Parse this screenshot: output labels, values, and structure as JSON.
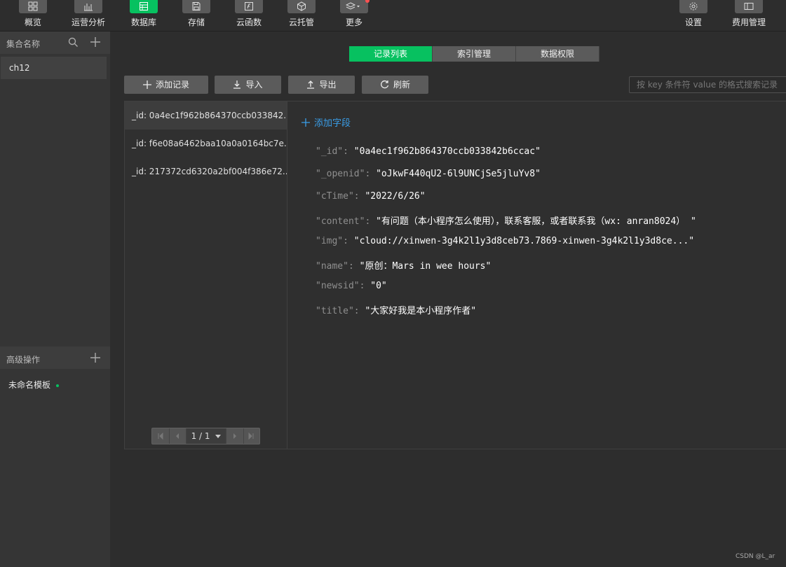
{
  "toolbar": {
    "items": [
      {
        "label": "概览",
        "icon": "overview-icon"
      },
      {
        "label": "运营分析",
        "icon": "chart-icon"
      },
      {
        "label": "数据库",
        "icon": "database-icon",
        "active": true
      },
      {
        "label": "存储",
        "icon": "storage-icon"
      },
      {
        "label": "云函数",
        "icon": "function-icon"
      },
      {
        "label": "云托管",
        "icon": "cube-icon"
      },
      {
        "label": "更多",
        "icon": "layers-icon"
      }
    ],
    "right_items": [
      {
        "label": "设置",
        "icon": "gear-icon"
      },
      {
        "label": "费用管理",
        "icon": "billing-icon"
      }
    ]
  },
  "sidebar": {
    "header_title": "集合名称",
    "collections": [
      "ch12"
    ],
    "advanced_title": "高级操作",
    "templates": [
      "未命名模板"
    ]
  },
  "tabs": [
    "记录列表",
    "索引管理",
    "数据权限"
  ],
  "actions": {
    "add": "添加记录",
    "import": "导入",
    "export": "导出",
    "refresh": "刷新"
  },
  "search": {
    "placeholder": "按 key 条件符 value 的格式搜索记录"
  },
  "records": [
    "_id: 0a4ec1f962b864370ccb033842...",
    "_id: f6e08a6462baa10a0a0164bc7e...",
    "_id: 217372cd6320a2bf004f386e72..."
  ],
  "pager": {
    "text": "1 / 1"
  },
  "detail": {
    "add_field": "添加字段",
    "fields": [
      {
        "key": "\"_id\"",
        "value": "\"0a4ec1f962b864370ccb033842b6ccac\""
      },
      {
        "key": "\"_openid\"",
        "value": "\"oJkwF440qU2-6l9UNCjSe5jluYv8\""
      },
      {
        "key": "\"cTime\"",
        "value": "\"2022/6/26\""
      },
      {
        "key": "\"content\"",
        "value": "\"有问题（本小程序怎么使用），联系客服，或者联系我（wx: anran8024） \""
      },
      {
        "key": "\"img\"",
        "value": "\"cloud://xinwen-3g4k2l1y3d8ceb73.7869-xinwen-3g4k2l1y3d8ce...\""
      },
      {
        "key": "\"name\"",
        "value": "\"原创：Mars in wee hours\""
      },
      {
        "key": "\"newsid\"",
        "value": "\"0\""
      },
      {
        "key": "\"title\"",
        "value": "\"大家好我是本小程序作者\""
      }
    ]
  },
  "watermark": "CSDN @L_ar",
  "colors": {
    "accent": "#07c160",
    "link": "#3a9ee8"
  }
}
